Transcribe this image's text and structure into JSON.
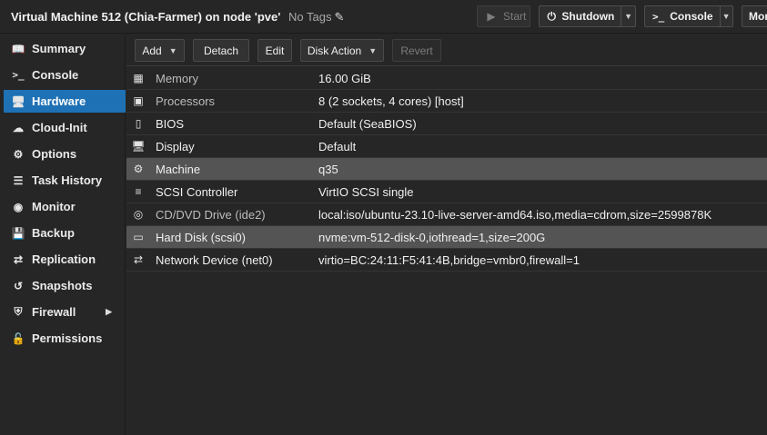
{
  "header": {
    "title": "Virtual Machine 512 (Chia-Farmer) on node 'pve'",
    "tags": "No Tags",
    "buttons": {
      "start": "Start",
      "shutdown": "Shutdown",
      "console": "Console",
      "more": "More"
    }
  },
  "sidebar": {
    "items": [
      {
        "label": "Summary",
        "icon": "book-icon"
      },
      {
        "label": "Console",
        "icon": "terminal-icon"
      },
      {
        "label": "Hardware",
        "icon": "desktop-icon",
        "active": true
      },
      {
        "label": "Cloud-Init",
        "icon": "cloud-icon"
      },
      {
        "label": "Options",
        "icon": "gear-icon"
      },
      {
        "label": "Task History",
        "icon": "list-icon"
      },
      {
        "label": "Monitor",
        "icon": "eye-icon"
      },
      {
        "label": "Backup",
        "icon": "floppy-icon"
      },
      {
        "label": "Replication",
        "icon": "retweet-icon"
      },
      {
        "label": "Snapshots",
        "icon": "history-icon"
      },
      {
        "label": "Firewall",
        "icon": "shield-icon"
      },
      {
        "label": "Permissions",
        "icon": "unlock-icon"
      }
    ]
  },
  "toolbar": {
    "add": "Add",
    "detach": "Detach",
    "edit": "Edit",
    "disk_action": "Disk Action",
    "revert": "Revert"
  },
  "hardware": [
    {
      "name": "Memory",
      "value": "16.00 GiB",
      "icon": "memory-icon"
    },
    {
      "name": "Processors",
      "value": "8 (2 sockets, 4 cores) [host]",
      "icon": "cpu-icon"
    },
    {
      "name": "BIOS",
      "value": "Default (SeaBIOS)",
      "icon": "microchip-icon"
    },
    {
      "name": "Display",
      "value": "Default",
      "icon": "desktop-icon"
    },
    {
      "name": "Machine",
      "value": "q35",
      "icon": "cogs-icon"
    },
    {
      "name": "SCSI Controller",
      "value": "VirtIO SCSI single",
      "icon": "database-icon"
    },
    {
      "name": "CD/DVD Drive (ide2)",
      "value": "local:iso/ubuntu-23.10-live-server-amd64.iso,media=cdrom,size=2599878K",
      "icon": "cdrom-icon"
    },
    {
      "name": "Hard Disk (scsi0)",
      "value": "nvme:vm-512-disk-0,iothread=1,size=200G",
      "icon": "hdd-icon"
    },
    {
      "name": "Network Device (net0)",
      "value": "virtio=BC:24:11:F5:41:4B,bridge=vmbr0,firewall=1",
      "icon": "exchange-icon"
    }
  ]
}
